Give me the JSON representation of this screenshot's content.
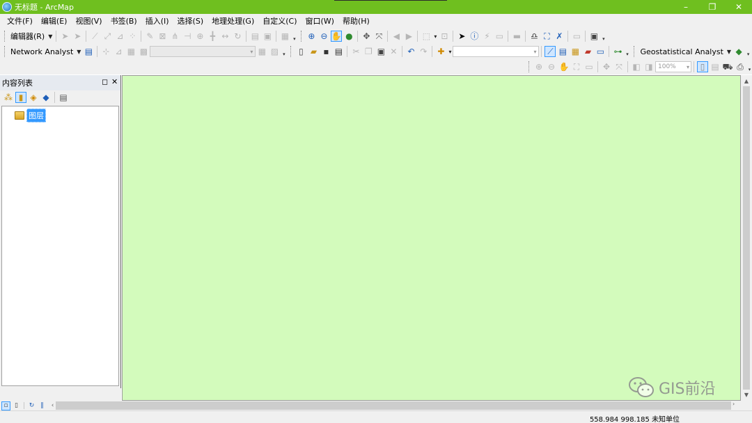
{
  "window": {
    "title": "无标题 - ArcMap",
    "controls": {
      "minimize": "–",
      "restore": "❐",
      "close": "✕"
    }
  },
  "menubar": {
    "items": [
      "文件(F)",
      "编辑(E)",
      "视图(V)",
      "书签(B)",
      "插入(I)",
      "选择(S)",
      "地理处理(G)",
      "自定义(C)",
      "窗口(W)",
      "帮助(H)"
    ]
  },
  "toolbars": {
    "editor_label": "编辑器(R)",
    "network_analyst_label": "Network Analyst",
    "geostatistical_label": "Geostatistical Analyst",
    "zoom_percent": "100%"
  },
  "toc": {
    "title": "内容列表",
    "root_layer": "图层"
  },
  "statusbar": {
    "coordinates": "558.984  998.185 未知单位"
  },
  "watermark": {
    "text": "GIS前沿"
  },
  "colors": {
    "titlebar": "#6fbf1f",
    "map_background": "#d3fbbc",
    "selection": "#3399ff"
  }
}
